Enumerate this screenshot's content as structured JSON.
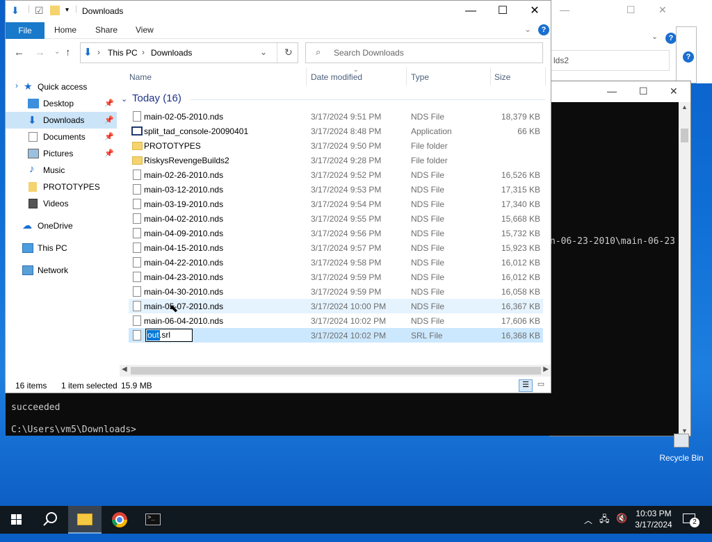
{
  "explorer": {
    "title": "Downloads",
    "ribbon_tabs": {
      "file": "File",
      "home": "Home",
      "share": "Share",
      "view": "View"
    },
    "address": {
      "root": "This PC",
      "current": "Downloads"
    },
    "search_placeholder": "Search Downloads",
    "columns": {
      "name": "Name",
      "date": "Date modified",
      "type": "Type",
      "size": "Size"
    },
    "group_label": "Today (16)",
    "nav": {
      "quick_access": "Quick access",
      "desktop": "Desktop",
      "downloads": "Downloads",
      "documents": "Documents",
      "pictures": "Pictures",
      "music": "Music",
      "prototypes": "PROTOTYPES",
      "videos": "Videos",
      "onedrive": "OneDrive",
      "this_pc": "This PC",
      "network": "Network"
    },
    "files": [
      {
        "name": "main-02-05-2010.nds",
        "date": "3/17/2024 9:51 PM",
        "type": "NDS File",
        "size": "18,379 KB"
      },
      {
        "name": "split_tad_console-20090401",
        "date": "3/17/2024 8:48 PM",
        "type": "Application",
        "size": "66 KB"
      },
      {
        "name": "PROTOTYPES",
        "date": "3/17/2024 9:50 PM",
        "type": "File folder",
        "size": ""
      },
      {
        "name": "RiskysRevengeBuilds2",
        "date": "3/17/2024 9:28 PM",
        "type": "File folder",
        "size": ""
      },
      {
        "name": "main-02-26-2010.nds",
        "date": "3/17/2024 9:52 PM",
        "type": "NDS File",
        "size": "16,526 KB"
      },
      {
        "name": "main-03-12-2010.nds",
        "date": "3/17/2024 9:53 PM",
        "type": "NDS File",
        "size": "17,315 KB"
      },
      {
        "name": "main-03-19-2010.nds",
        "date": "3/17/2024 9:54 PM",
        "type": "NDS File",
        "size": "17,340 KB"
      },
      {
        "name": "main-04-02-2010.nds",
        "date": "3/17/2024 9:55 PM",
        "type": "NDS File",
        "size": "15,668 KB"
      },
      {
        "name": "main-04-09-2010.nds",
        "date": "3/17/2024 9:56 PM",
        "type": "NDS File",
        "size": "15,732 KB"
      },
      {
        "name": "main-04-15-2010.nds",
        "date": "3/17/2024 9:57 PM",
        "type": "NDS File",
        "size": "15,923 KB"
      },
      {
        "name": "main-04-22-2010.nds",
        "date": "3/17/2024 9:58 PM",
        "type": "NDS File",
        "size": "16,012 KB"
      },
      {
        "name": "main-04-23-2010.nds",
        "date": "3/17/2024 9:59 PM",
        "type": "NDS File",
        "size": "16,012 KB"
      },
      {
        "name": "main-04-30-2010.nds",
        "date": "3/17/2024 9:59 PM",
        "type": "NDS File",
        "size": "16,058 KB"
      },
      {
        "name": "main-05-07-2010.nds",
        "date": "3/17/2024 10:00 PM",
        "type": "NDS File",
        "size": "16,367 KB"
      },
      {
        "name": "main-06-04-2010.nds",
        "date": "3/17/2024 10:02 PM",
        "type": "NDS File",
        "size": "17,606 KB"
      },
      {
        "name": "out.srl",
        "date": "3/17/2024 10:02 PM",
        "type": "SRL File",
        "size": "16,368 KB"
      }
    ],
    "rename": {
      "selected": "out",
      "rest": ".srl"
    },
    "status": {
      "count": "16 items",
      "selected": "1 item selected",
      "size": "15.9 MB"
    }
  },
  "background_window": {
    "address_text": "lds2"
  },
  "console": {
    "path_fragment": "n-06-23-2010\\main-06-23",
    "line_succeeded": "succeeded",
    "prompt": "C:\\Users\\vm5\\Downloads>"
  },
  "desktop": {
    "recycle_bin": "Recycle Bin"
  },
  "taskbar": {
    "time": "10:03 PM",
    "date": "3/17/2024",
    "notifications": "2"
  }
}
